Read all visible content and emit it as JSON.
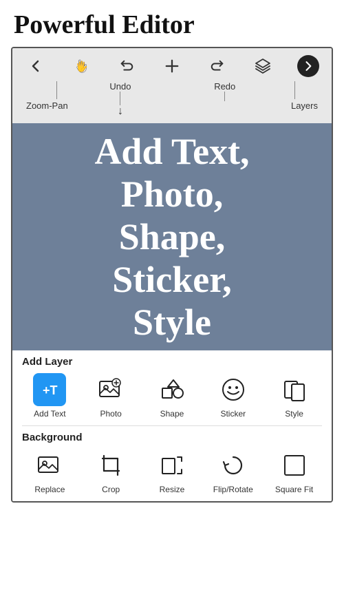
{
  "page": {
    "title": "Powerful Editor"
  },
  "toolbar": {
    "icons": [
      {
        "name": "back-icon",
        "symbol": "←",
        "interactable": true
      },
      {
        "name": "pan-icon",
        "symbol": "✋",
        "interactable": true
      },
      {
        "name": "undo-icon",
        "symbol": "↩",
        "interactable": true
      },
      {
        "name": "add-icon",
        "symbol": "+",
        "interactable": true
      },
      {
        "name": "redo-icon",
        "symbol": "↪",
        "interactable": true
      },
      {
        "name": "layers-icon",
        "symbol": "⬡",
        "interactable": true
      },
      {
        "name": "next-icon",
        "symbol": "→",
        "interactable": true,
        "accent": true
      }
    ],
    "labels": {
      "zoom_pan": "Zoom-Pan",
      "undo": "Undo",
      "redo": "Redo",
      "layers": "Layers"
    }
  },
  "canvas": {
    "text": "Add Text,\nPhoto,\nShape,\nSticker,\nStyle"
  },
  "add_layer": {
    "section_title": "Add Layer",
    "tools": [
      {
        "name": "add-text-tool",
        "label": "Add Text",
        "icon": "+T",
        "has_blue_bg": true
      },
      {
        "name": "photo-tool",
        "label": "Photo",
        "icon": "photo",
        "has_blue_bg": false
      },
      {
        "name": "shape-tool",
        "label": "Shape",
        "icon": "shape",
        "has_blue_bg": false
      },
      {
        "name": "sticker-tool",
        "label": "Sticker",
        "icon": "sticker",
        "has_blue_bg": false
      },
      {
        "name": "style-tool",
        "label": "Style",
        "icon": "style",
        "has_blue_bg": false
      }
    ]
  },
  "background": {
    "section_title": "Background",
    "tools": [
      {
        "name": "replace-tool",
        "label": "Replace",
        "icon": "replace"
      },
      {
        "name": "crop-tool",
        "label": "Crop",
        "icon": "crop"
      },
      {
        "name": "resize-tool",
        "label": "Resize",
        "icon": "resize"
      },
      {
        "name": "flip-rotate-tool",
        "label": "Flip/Rotate",
        "icon": "flip"
      },
      {
        "name": "square-fit-tool",
        "label": "Square Fit",
        "icon": "square"
      }
    ]
  }
}
